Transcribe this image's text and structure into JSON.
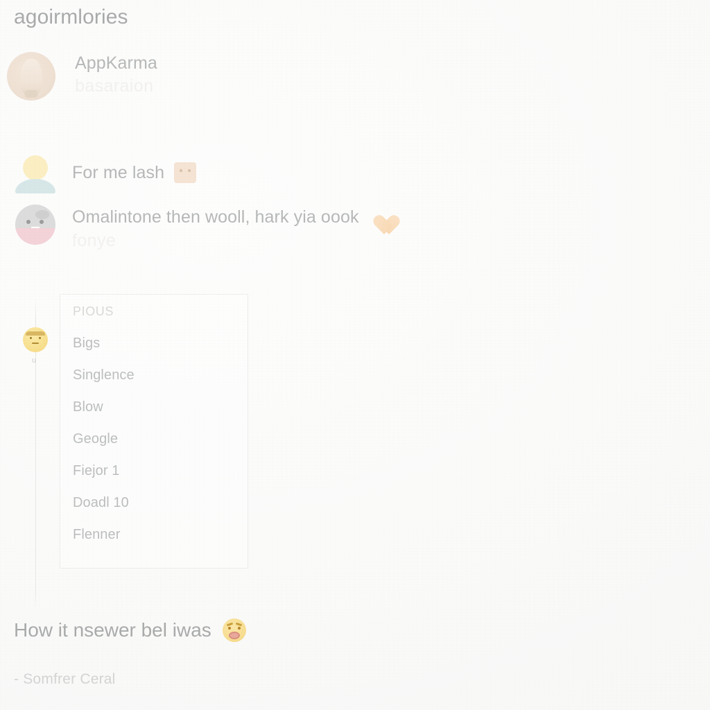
{
  "page": {
    "title": "agoirmlories",
    "background_color": "#fafaf9"
  },
  "feed": {
    "rows": [
      {
        "avatar": "beige-portrait-avatar",
        "primary": "AppKarma",
        "secondary": "basaraion",
        "emoji": ""
      },
      {
        "avatar": "person-silhouette-avatar",
        "primary": "For me lash",
        "secondary": "",
        "emoji": "square-face-emoji"
      },
      {
        "avatar": "grey-pink-face-avatar",
        "primary": "Omalintone then wooll, hark yia oook",
        "secondary": "fonye",
        "emoji": "orange-heart-emoji"
      }
    ]
  },
  "thread": {
    "avatar": "yellow-face-emoji-avatar",
    "tag": "u"
  },
  "list_card": {
    "heading": "PIOUS",
    "items": [
      "Bigs",
      "Singlence",
      "Blow",
      "Geogle",
      "Fiejor 1",
      "Doadl 10",
      "Flenner"
    ]
  },
  "quote": {
    "text": "How it nsewer bel iwas",
    "emoji": "anguished-face-emoji",
    "author": "- Somfrer Ceral"
  },
  "colors": {
    "text_primary": "#a9abab",
    "text_muted": "#bcbebe",
    "text_faint": "#f2f1ef",
    "border": "#ededec",
    "accent_yellow": "#f7de8d",
    "accent_peach": "#f8d9b4",
    "accent_pink": "#f3d2d8",
    "accent_teal": "#d7e7e8"
  }
}
